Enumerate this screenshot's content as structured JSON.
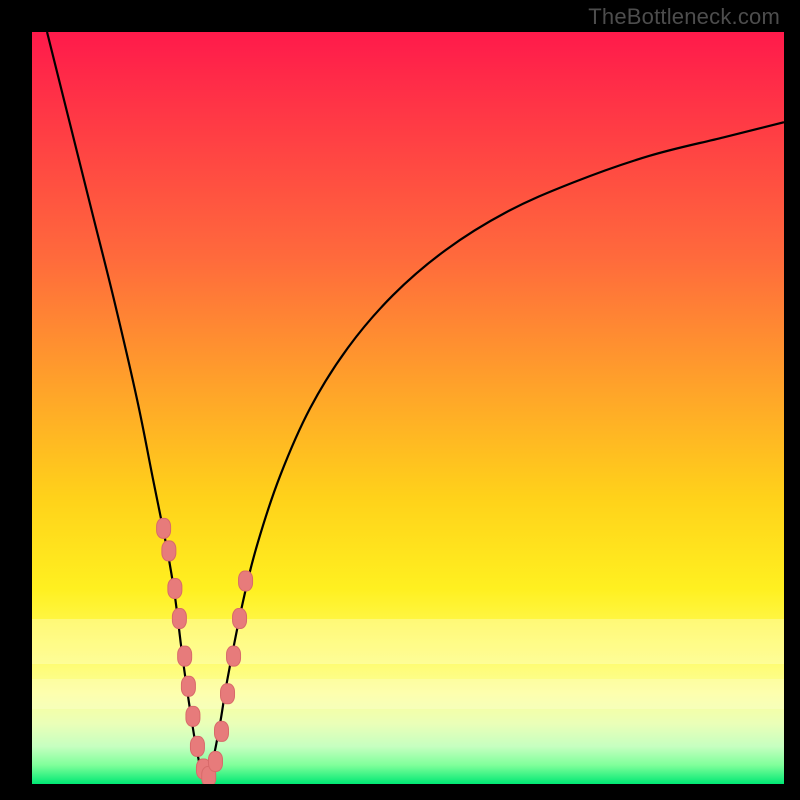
{
  "watermark": "TheBottleneck.com",
  "colors": {
    "frame": "#000000",
    "curve": "#000000",
    "markerFill": "#e77b7b",
    "markerStroke": "#d86a6a"
  },
  "chart_data": {
    "type": "line",
    "title": "",
    "xlabel": "",
    "ylabel": "",
    "xlim": [
      0,
      100
    ],
    "ylim": [
      0,
      100
    ],
    "note": "V-shaped bottleneck curve. y is bottleneck percentage (0 at bottom / green, 100 at top / red). Minimum (~0%) occurs near x≈23.",
    "series": [
      {
        "name": "bottleneck-curve",
        "x": [
          2,
          5,
          8,
          11,
          14,
          16,
          18,
          19,
          20,
          21,
          22,
          23,
          24,
          25,
          26,
          28,
          30,
          33,
          37,
          42,
          48,
          55,
          63,
          72,
          82,
          92,
          100
        ],
        "values": [
          100,
          88,
          76,
          64,
          51,
          41,
          31,
          25,
          17,
          10,
          4,
          0.5,
          3,
          8,
          14,
          24,
          32,
          41,
          50,
          58,
          65,
          71,
          76,
          80,
          83.5,
          86,
          88
        ]
      }
    ],
    "markers": {
      "name": "highlighted-points",
      "x": [
        17.5,
        18.2,
        19.0,
        19.6,
        20.3,
        20.8,
        21.4,
        22.0,
        22.8,
        23.5,
        24.4,
        25.2,
        26.0,
        26.8,
        27.6,
        28.4
      ],
      "values": [
        34,
        31,
        26,
        22,
        17,
        13,
        9,
        5,
        2,
        1,
        3,
        7,
        12,
        17,
        22,
        27
      ]
    }
  }
}
